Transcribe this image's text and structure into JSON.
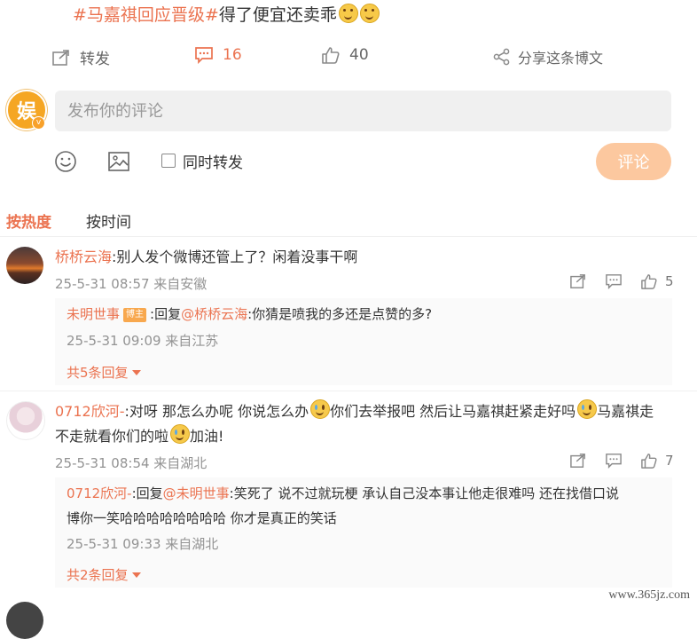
{
  "post": {
    "hashtag": "#马嘉祺回应晋级#",
    "text": "得了便宜还卖乖"
  },
  "actions": {
    "repost_label": "转发",
    "comment_count": "16",
    "like_count": "40",
    "share_label": "分享这条博文"
  },
  "composer": {
    "placeholder": "发布你的评论",
    "repost_checkbox_label": "同时转发",
    "submit_label": "评论"
  },
  "sort": {
    "by_hot": "按热度",
    "by_time": "按时间"
  },
  "comments": [
    {
      "user": "桥桥云海",
      "text": ":别人发个微博还管上了？闲着没事干啊",
      "time": "25-5-31 08:57 来自安徽",
      "likes": "5",
      "reply": {
        "user": "未明世事",
        "badge": "博主",
        "prefix": ":回复",
        "mention": "@桥桥云海",
        "text": ":你猜是喷我的多还是点赞的多?",
        "time": "25-5-31 09:09 来自江苏"
      },
      "more_replies": "共5条回复"
    },
    {
      "user": "0712欣河-",
      "text_a": ":对呀 那怎么办呢 你说怎么办",
      "text_b": "你们去举报吧 然后让马嘉祺赶紧走好吗",
      "text_c": "马嘉祺走",
      "text_d": "不走就看你们的啦",
      "text_e": "加油!",
      "time": "25-5-31 08:54 来自湖北",
      "likes": "7",
      "reply": {
        "user": "0712欣河-",
        "prefix": ":回复",
        "mention": "@未明世事",
        "text": ":笑死了 说不过就玩梗 承认自己没本事让他走很难吗 还在找借口说",
        "text2": "博你一笑哈哈哈哈哈哈哈哈 你才是真正的笑话",
        "time": "25-5-31 09:33 来自湖北"
      },
      "more_replies": "共2条回复"
    }
  ],
  "watermark": "www.365jz.com",
  "colors": {
    "accent": "#eb7350",
    "submit_bg": "#fcc89f"
  }
}
